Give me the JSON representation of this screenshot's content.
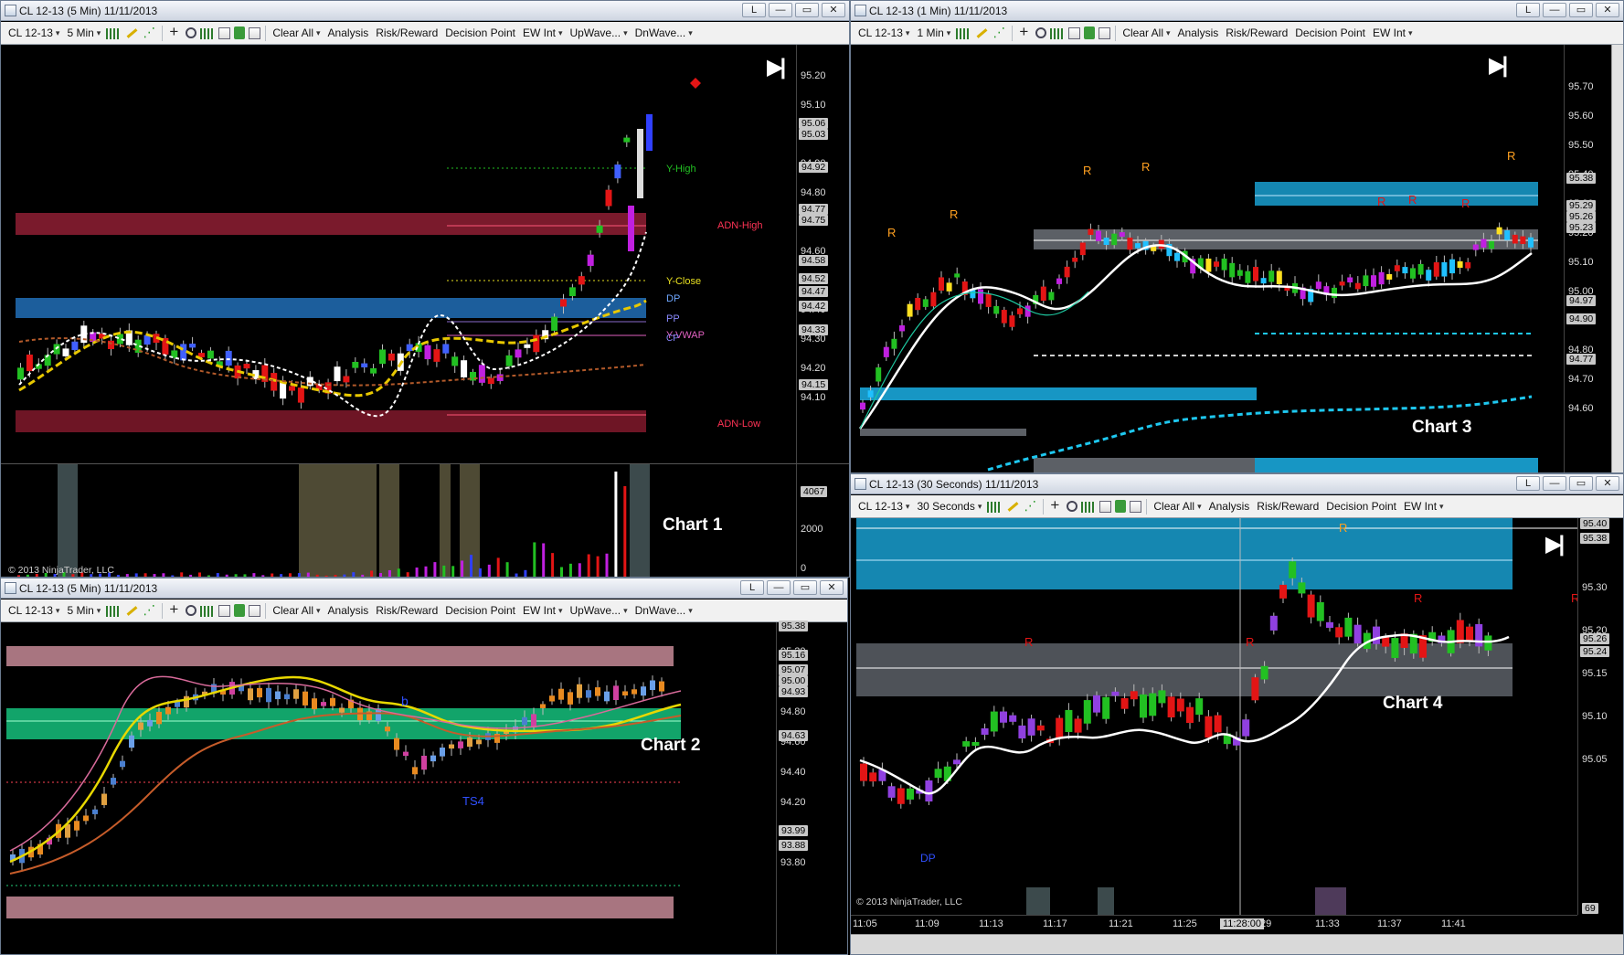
{
  "windows": {
    "w1": {
      "title": "CL 12-13 (5 Min)  11/11/2013",
      "instrument": "CL 12-13",
      "interval": "5 Min",
      "chart_name": "Chart 1",
      "copyright": "© 2013 NinjaTrader, LLC",
      "prices": [
        "95.20",
        "95.10",
        "95.00",
        "94.90",
        "94.80",
        "94.70",
        "94.60",
        "94.50",
        "94.40",
        "94.30",
        "94.20",
        "94.10"
      ],
      "badges": [
        "95.06",
        "95.03",
        "94.92",
        "94.77",
        "94.75",
        "94.58",
        "94.52",
        "94.47",
        "94.42",
        "94.33",
        "94.15"
      ],
      "vol_labels": [
        "4067",
        "2000",
        "0"
      ],
      "levels": {
        "y_high": "Y-High",
        "adn_high": "ADN-High",
        "y_close": "Y-Close",
        "dp": "DP",
        "pp": "PP",
        "vwap": "Y-VWAP",
        "cp": "CP",
        "adn_low": "ADN-Low"
      }
    },
    "w2": {
      "title": "CL 12-13 (5 Min)  11/11/2013",
      "instrument": "CL 12-13",
      "interval": "5 Min",
      "chart_name": "Chart 2",
      "prices": [
        "95.20",
        "95.00",
        "94.80",
        "94.60",
        "94.40",
        "94.20",
        "94.00",
        "93.80"
      ],
      "badges": [
        "95.38",
        "95.16",
        "95.07",
        "95.00",
        "94.93",
        "94.63",
        "93.99",
        "93.88"
      ],
      "marks": {
        "ts4": "TS4",
        "b": "b"
      }
    },
    "w3": {
      "title": "CL 12-13 (1 Min)  11/11/2013",
      "instrument": "CL 12-13",
      "interval": "1 Min",
      "chart_name": "Chart 3",
      "prices": [
        "95.70",
        "95.60",
        "95.50",
        "95.40",
        "95.30",
        "95.20",
        "95.10",
        "95.00",
        "94.90",
        "94.80",
        "94.70",
        "94.60"
      ],
      "badges": [
        "95.38",
        "95.29",
        "95.26",
        "95.23",
        "94.97",
        "94.90",
        "94.77"
      ],
      "r_mark": "R"
    },
    "w4": {
      "title": "CL 12-13 (30 Seconds)  11/11/2013",
      "instrument": "CL 12-13",
      "interval": "30 Seconds",
      "chart_name": "Chart 4",
      "copyright": "© 2013 NinjaTrader, LLC",
      "prices": [
        "95.30",
        "95.20",
        "95.15",
        "95.10",
        "95.05"
      ],
      "badges": [
        "95.40",
        "95.38",
        "95.26",
        "95.24"
      ],
      "times": [
        "11:05",
        "11:09",
        "11:13",
        "11:17",
        "11:21",
        "11:25",
        "11:28:00",
        "29",
        "11:33",
        "11:37",
        "11:41"
      ],
      "vol_badge": "69",
      "r_mark": "R",
      "dp": "DP"
    }
  },
  "toolbar": {
    "clear_all": "Clear All",
    "analysis": "Analysis",
    "risk_reward": "Risk/Reward",
    "decision_point": "Decision Point",
    "ew_int": "EW Int",
    "upwave": "UpWave...",
    "dnwave": "DnWave..."
  },
  "window_buttons": {
    "link": "L",
    "minimize": "—",
    "restore": "▭",
    "close": "✕"
  },
  "colors": {
    "up": "#22c022",
    "down": "#e31515",
    "cyan_zone": "#1e7fb0",
    "pink_zone": "#7a1a2c"
  }
}
